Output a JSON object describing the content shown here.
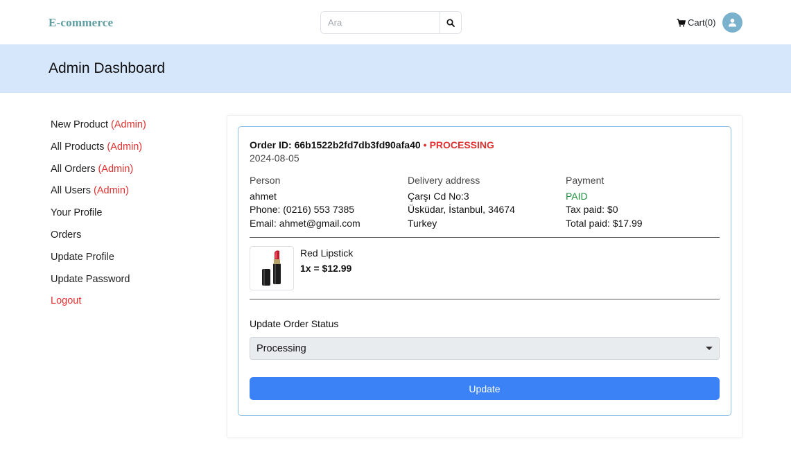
{
  "header": {
    "brand": "E-commerce",
    "search_placeholder": "Ara",
    "cart_label": "Cart(0)"
  },
  "banner": {
    "title": "Admin Dashboard"
  },
  "sidebar": {
    "items": [
      {
        "label": "New Product",
        "badge": "(Admin)"
      },
      {
        "label": "All Products",
        "badge": "(Admin)"
      },
      {
        "label": "All Orders",
        "badge": "(Admin)"
      },
      {
        "label": "All Users",
        "badge": "(Admin)"
      },
      {
        "label": "Your Profile"
      },
      {
        "label": "Orders"
      },
      {
        "label": "Update Profile"
      },
      {
        "label": "Update Password"
      },
      {
        "label": "Logout"
      }
    ]
  },
  "order": {
    "id_label": "Order ID: 66b1522b2fd7db3fd90afa40",
    "separator": "•",
    "status": "PROCESSING",
    "date": "2024-08-05",
    "person": {
      "label": "Person",
      "name": "ahmet",
      "phone": "Phone: (0216) 553 7385",
      "email": "Email: ahmet@gmail.com"
    },
    "delivery": {
      "label": "Delivery address",
      "line1": "Çarşı Cd No:3",
      "line2": "Üsküdar, İstanbul, 34674",
      "line3": "Turkey"
    },
    "payment": {
      "label": "Payment",
      "status": "PAID",
      "tax": "Tax paid: $0",
      "total": "Total paid: $17.99"
    },
    "item": {
      "name": "Red Lipstick",
      "price_line": "1x = $12.99"
    },
    "update_status_label": "Update Order Status",
    "selected_status": "Processing",
    "update_button": "Update"
  },
  "colors": {
    "accent": "#3b82f6",
    "banner": "#d6e6fb",
    "danger": "#e03131",
    "success": "#1e8e3e",
    "brand": "#5f9ea0"
  }
}
